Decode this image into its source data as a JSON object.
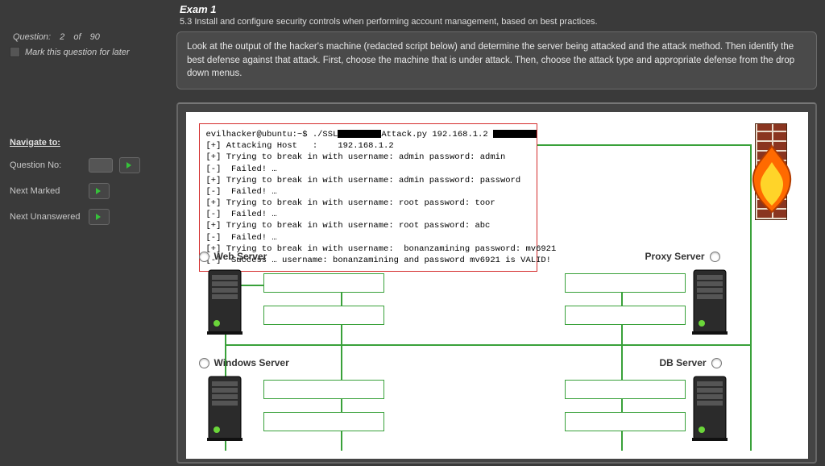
{
  "sidebar": {
    "question_meta": {
      "label": "Question:",
      "current": "2",
      "of": "of",
      "total": "90"
    },
    "mark_label": "Mark this question for later",
    "navigate_title": "Navigate to:",
    "rows": {
      "question_no": "Question No:",
      "next_marked": "Next Marked",
      "next_unanswered": "Next Unanswered"
    }
  },
  "exam": {
    "title": "Exam 1",
    "objective": "5.3 Install and configure security controls when performing account management, based on best practices.",
    "question_text": "Look at the output of the hacker's machine (redacted script below) and determine the server being attacked and the attack method. Then identify the best defense against that attack. First, choose the machine that is under attack. Then, choose the attack type and appropriate defense from the drop down menus."
  },
  "terminal": {
    "lines": [
      {
        "text": "evilhacker@ubuntu:~$ ./SSL",
        "mask1_w": 54,
        "mid": "Attack.py 192.168.1.2 ",
        "mask2_w": 54
      },
      {
        "text": "[+] Attacking Host   :    192.168.1.2"
      },
      {
        "text": "[+] Trying to break in with username: admin password: admin"
      },
      {
        "text": "[-]  Failed! …"
      },
      {
        "text": "[+] Trying to break in with username: admin password: password"
      },
      {
        "text": "[-]  Failed! …"
      },
      {
        "text": "[+] Trying to break in with username: root password: toor"
      },
      {
        "text": "[-]  Failed! …"
      },
      {
        "text": "[+] Trying to break in with username: root password: abc"
      },
      {
        "text": "[-]  Failed! …"
      },
      {
        "text": "[+] Trying to break in with username:  bonanzamining password: mv6921"
      },
      {
        "text": "[-]  Success … username: bonanzamining and password mv6921 is VALID!"
      }
    ]
  },
  "servers": {
    "web": "Web Server",
    "proxy": "Proxy Server",
    "windows": "Windows Server",
    "db": "DB Server"
  }
}
